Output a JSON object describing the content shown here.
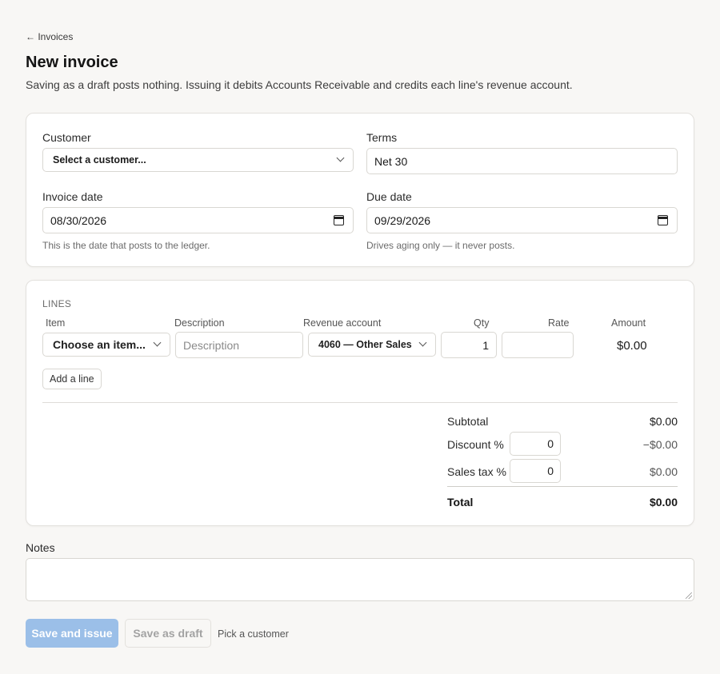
{
  "nav": {
    "back_label": "← Invoices"
  },
  "page": {
    "title": "New invoice",
    "subtitle": "Saving as a draft posts nothing. Issuing it debits Accounts Receivable and credits each line's revenue account."
  },
  "header": {
    "customer_label": "Customer",
    "customer_value": "Select a customer...",
    "terms_label": "Terms",
    "terms_value": "Net 30",
    "invoice_date_label": "Invoice date",
    "invoice_date_value": "08/30/2026",
    "invoice_date_help": "This is the date that posts to the ledger.",
    "due_date_label": "Due date",
    "due_date_value": "09/29/2026",
    "due_date_help": "Drives aging only — it never posts."
  },
  "lines": {
    "section_label": "LINES",
    "columns": {
      "item": "Item",
      "description": "Description",
      "revenue_account": "Revenue account",
      "qty": "Qty",
      "rate": "Rate",
      "amount": "Amount"
    },
    "rows": [
      {
        "item": "Choose an item...",
        "description_placeholder": "Description",
        "revenue_account": "4060 — Other Sales",
        "qty": "1",
        "rate": "",
        "amount": "$0.00"
      }
    ],
    "add_line_label": "Add a line"
  },
  "totals": {
    "subtotal_label": "Subtotal",
    "subtotal_value": "$0.00",
    "discount_label": "Discount %",
    "discount_input": "0",
    "discount_value": "−$0.00",
    "tax_label": "Sales tax %",
    "tax_input": "0",
    "tax_value": "$0.00",
    "total_label": "Total",
    "total_value": "$0.00"
  },
  "notes": {
    "label": "Notes",
    "value": ""
  },
  "actions": {
    "save_issue_label": "Save and issue",
    "save_draft_label": "Save as draft",
    "hint": "Pick a customer"
  },
  "colors": {
    "primary_disabled": "#9bbfe8",
    "background": "#f8f7f5",
    "card": "#ffffff"
  }
}
